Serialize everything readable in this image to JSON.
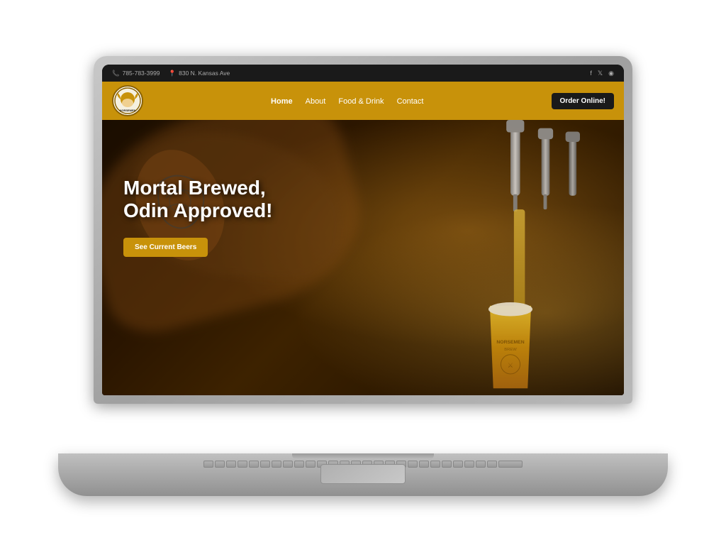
{
  "laptop": {
    "title": "Laptop mockup showing Norsemen Brewing website"
  },
  "topbar": {
    "phone": "785-783-3999",
    "address": "830 N. Kansas Ave",
    "phone_icon": "📞",
    "location_icon": "📍",
    "socials": [
      "f",
      "🐦",
      "📷"
    ]
  },
  "navbar": {
    "logo_icon": "⚔️",
    "links": [
      {
        "label": "Home",
        "active": true
      },
      {
        "label": "About",
        "active": false
      },
      {
        "label": "Food & Drink",
        "active": false
      },
      {
        "label": "Contact",
        "active": false
      }
    ],
    "cta_label": "Order Online!"
  },
  "hero": {
    "headline_line1": "Mortal Brewed,",
    "headline_line2": "Odin Approved!",
    "cta_label": "See Current Beers",
    "brand_name": "NORSEMEN",
    "brand_sub": "BREW"
  }
}
